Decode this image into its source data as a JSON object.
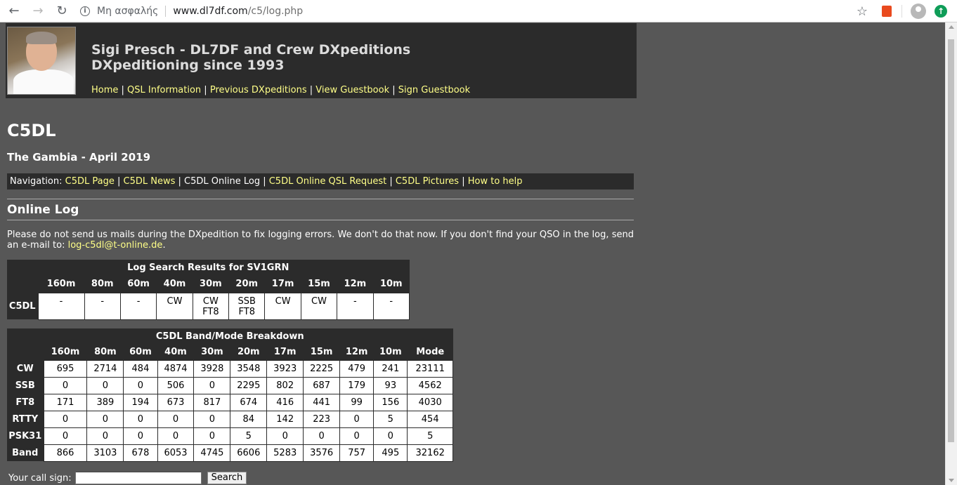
{
  "browser": {
    "security_label": "Μη ασφαλής",
    "url_host": "www.dl7df.com",
    "url_path": "/c5/log.php"
  },
  "header": {
    "title_line1": "Sigi Presch - DL7DF and Crew DXpeditions",
    "title_line2": "DXpeditioning since 1993",
    "nav": [
      "Home",
      "QSL Information",
      "Previous DXpeditions",
      "View Guestbook",
      "Sign Guestbook"
    ]
  },
  "page": {
    "callsign": "C5DL",
    "subtitle": "The Gambia - April 2019",
    "nav_prefix": "Navigation: ",
    "nav": [
      "C5DL Page",
      "C5DL News",
      "C5DL Online Log",
      "C5DL Online QSL Request",
      "C5DL Pictures",
      "How to help"
    ],
    "section_title": "Online Log",
    "notice_text": "Please do not send us mails during the DXpedition to fix logging errors. We don't do that now. If you don't find your QSO in the log, send an e-mail to: ",
    "notice_email": "log-c5dl@t-online.de",
    "notice_end": "."
  },
  "search_results": {
    "caption": "Log Search Results for SV1GRN",
    "bands": [
      "160m",
      "80m",
      "60m",
      "40m",
      "30m",
      "20m",
      "17m",
      "15m",
      "12m",
      "10m"
    ],
    "row_label": "C5DL",
    "cells": [
      "-",
      "-",
      "-",
      "CW",
      "CW\nFT8",
      "SSB\nFT8",
      "CW",
      "CW",
      "-",
      "-"
    ]
  },
  "breakdown": {
    "caption": "C5DL Band/Mode Breakdown",
    "columns": [
      "160m",
      "80m",
      "60m",
      "40m",
      "30m",
      "20m",
      "17m",
      "15m",
      "12m",
      "10m",
      "Mode"
    ],
    "rows": [
      {
        "label": "CW",
        "values": [
          "695",
          "2714",
          "484",
          "4874",
          "3928",
          "3548",
          "3923",
          "2225",
          "479",
          "241",
          "23111"
        ]
      },
      {
        "label": "SSB",
        "values": [
          "0",
          "0",
          "0",
          "506",
          "0",
          "2295",
          "802",
          "687",
          "179",
          "93",
          "4562"
        ]
      },
      {
        "label": "FT8",
        "values": [
          "171",
          "389",
          "194",
          "673",
          "817",
          "674",
          "416",
          "441",
          "99",
          "156",
          "4030"
        ]
      },
      {
        "label": "RTTY",
        "values": [
          "0",
          "0",
          "0",
          "0",
          "0",
          "84",
          "142",
          "223",
          "0",
          "5",
          "454"
        ]
      },
      {
        "label": "PSK31",
        "values": [
          "0",
          "0",
          "0",
          "0",
          "0",
          "5",
          "0",
          "0",
          "0",
          "0",
          "5"
        ]
      },
      {
        "label": "Band",
        "values": [
          "866",
          "3103",
          "678",
          "6053",
          "4745",
          "6606",
          "5283",
          "3576",
          "757",
          "495",
          "32162"
        ]
      }
    ]
  },
  "search_form": {
    "label": "Your call sign:",
    "button": "Search"
  }
}
